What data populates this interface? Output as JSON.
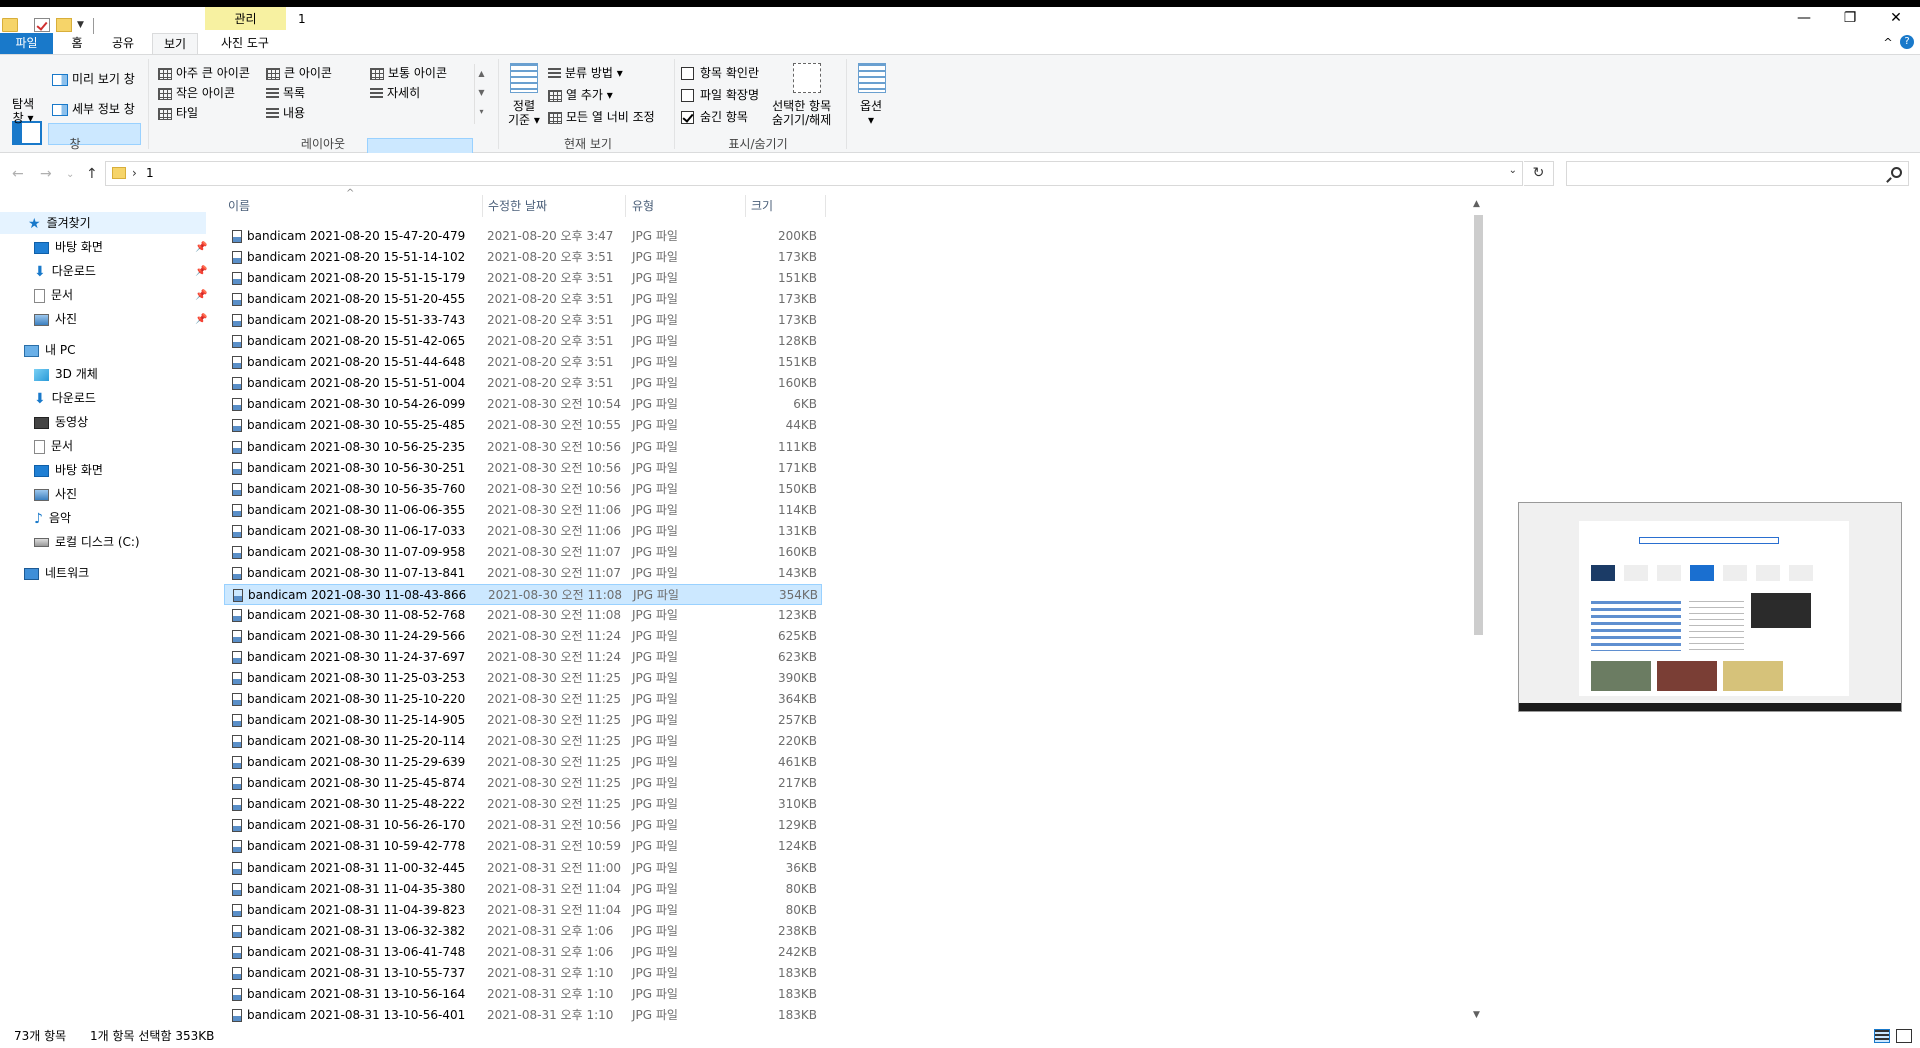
{
  "window": {
    "title": "1",
    "context_tab_group": "관리",
    "minimize_glyph": "—",
    "maximize_glyph": "❐",
    "close_glyph": "✕",
    "help_glyph": "?",
    "ribbon_toggle_glyph": "^"
  },
  "ribbon_tabs": [
    "파일",
    "홈",
    "공유",
    "보기",
    "사진 도구"
  ],
  "ribbon": {
    "panes": {
      "nav_pane": "탐색\n창 ▾",
      "preview_pane": "미리 보기 창",
      "details_pane": "세부 정보 창",
      "label": "창"
    },
    "layout": {
      "items": [
        "아주 큰 아이콘",
        "큰 아이콘",
        "보통 아이콘",
        "작은 아이콘",
        "목록",
        "자세히",
        "타일",
        "내용"
      ],
      "label": "레이아웃"
    },
    "current_view": {
      "sort": "정렬\n기준 ▾",
      "group_by": "분류 방법 ▾",
      "add_columns": "열 추가 ▾",
      "fit_columns": "모든 열 너비 조정",
      "label": "현재 보기"
    },
    "show_hide": {
      "item_checkboxes": "항목 확인란",
      "file_extensions": "파일 확장명",
      "hidden_items": "숨긴 항목",
      "hide_selected": "선택한 항목\n숨기기/해제",
      "label": "표시/숨기기"
    },
    "options": "옵션\n▾"
  },
  "address": {
    "path": "1",
    "back": "←",
    "forward": "→",
    "recent": "⌄",
    "up": "↑",
    "refresh": "↻",
    "search_placeholder": ""
  },
  "nav": {
    "quick_access": "즐겨찾기",
    "quick_items": [
      "바탕 화면",
      "다운로드",
      "문서",
      "사진"
    ],
    "this_pc": "내 PC",
    "pc_items": [
      "3D 개체",
      "다운로드",
      "동영상",
      "문서",
      "바탕 화면",
      "사진",
      "음악",
      "로컬 디스크 (C:)"
    ],
    "network": "네트워크"
  },
  "columns": {
    "name": "이름",
    "date": "수정한 날짜",
    "type": "유형",
    "size": "크기"
  },
  "files": [
    {
      "name": "bandicam 2021-08-20 15-47-20-479",
      "date": "2021-08-20 오후 3:47",
      "type": "JPG 파일",
      "size": "200KB"
    },
    {
      "name": "bandicam 2021-08-20 15-51-14-102",
      "date": "2021-08-20 오후 3:51",
      "type": "JPG 파일",
      "size": "173KB"
    },
    {
      "name": "bandicam 2021-08-20 15-51-15-179",
      "date": "2021-08-20 오후 3:51",
      "type": "JPG 파일",
      "size": "151KB"
    },
    {
      "name": "bandicam 2021-08-20 15-51-20-455",
      "date": "2021-08-20 오후 3:51",
      "type": "JPG 파일",
      "size": "173KB"
    },
    {
      "name": "bandicam 2021-08-20 15-51-33-743",
      "date": "2021-08-20 오후 3:51",
      "type": "JPG 파일",
      "size": "173KB"
    },
    {
      "name": "bandicam 2021-08-20 15-51-42-065",
      "date": "2021-08-20 오후 3:51",
      "type": "JPG 파일",
      "size": "128KB"
    },
    {
      "name": "bandicam 2021-08-20 15-51-44-648",
      "date": "2021-08-20 오후 3:51",
      "type": "JPG 파일",
      "size": "151KB"
    },
    {
      "name": "bandicam 2021-08-20 15-51-51-004",
      "date": "2021-08-20 오후 3:51",
      "type": "JPG 파일",
      "size": "160KB"
    },
    {
      "name": "bandicam 2021-08-30 10-54-26-099",
      "date": "2021-08-30 오전 10:54",
      "type": "JPG 파일",
      "size": "6KB"
    },
    {
      "name": "bandicam 2021-08-30 10-55-25-485",
      "date": "2021-08-30 오전 10:55",
      "type": "JPG 파일",
      "size": "44KB"
    },
    {
      "name": "bandicam 2021-08-30 10-56-25-235",
      "date": "2021-08-30 오전 10:56",
      "type": "JPG 파일",
      "size": "111KB"
    },
    {
      "name": "bandicam 2021-08-30 10-56-30-251",
      "date": "2021-08-30 오전 10:56",
      "type": "JPG 파일",
      "size": "171KB"
    },
    {
      "name": "bandicam 2021-08-30 10-56-35-760",
      "date": "2021-08-30 오전 10:56",
      "type": "JPG 파일",
      "size": "150KB"
    },
    {
      "name": "bandicam 2021-08-30 11-06-06-355",
      "date": "2021-08-30 오전 11:06",
      "type": "JPG 파일",
      "size": "114KB"
    },
    {
      "name": "bandicam 2021-08-30 11-06-17-033",
      "date": "2021-08-30 오전 11:06",
      "type": "JPG 파일",
      "size": "131KB"
    },
    {
      "name": "bandicam 2021-08-30 11-07-09-958",
      "date": "2021-08-30 오전 11:07",
      "type": "JPG 파일",
      "size": "160KB"
    },
    {
      "name": "bandicam 2021-08-30 11-07-13-841",
      "date": "2021-08-30 오전 11:07",
      "type": "JPG 파일",
      "size": "143KB"
    },
    {
      "name": "bandicam 2021-08-30 11-08-43-866",
      "date": "2021-08-30 오전 11:08",
      "type": "JPG 파일",
      "size": "354KB",
      "selected": true
    },
    {
      "name": "bandicam 2021-08-30 11-08-52-768",
      "date": "2021-08-30 오전 11:08",
      "type": "JPG 파일",
      "size": "123KB"
    },
    {
      "name": "bandicam 2021-08-30 11-24-29-566",
      "date": "2021-08-30 오전 11:24",
      "type": "JPG 파일",
      "size": "625KB"
    },
    {
      "name": "bandicam 2021-08-30 11-24-37-697",
      "date": "2021-08-30 오전 11:24",
      "type": "JPG 파일",
      "size": "623KB"
    },
    {
      "name": "bandicam 2021-08-30 11-25-03-253",
      "date": "2021-08-30 오전 11:25",
      "type": "JPG 파일",
      "size": "390KB"
    },
    {
      "name": "bandicam 2021-08-30 11-25-10-220",
      "date": "2021-08-30 오전 11:25",
      "type": "JPG 파일",
      "size": "364KB"
    },
    {
      "name": "bandicam 2021-08-30 11-25-14-905",
      "date": "2021-08-30 오전 11:25",
      "type": "JPG 파일",
      "size": "257KB"
    },
    {
      "name": "bandicam 2021-08-30 11-25-20-114",
      "date": "2021-08-30 오전 11:25",
      "type": "JPG 파일",
      "size": "220KB"
    },
    {
      "name": "bandicam 2021-08-30 11-25-29-639",
      "date": "2021-08-30 오전 11:25",
      "type": "JPG 파일",
      "size": "461KB"
    },
    {
      "name": "bandicam 2021-08-30 11-25-45-874",
      "date": "2021-08-30 오전 11:25",
      "type": "JPG 파일",
      "size": "217KB"
    },
    {
      "name": "bandicam 2021-08-30 11-25-48-222",
      "date": "2021-08-30 오전 11:25",
      "type": "JPG 파일",
      "size": "310KB"
    },
    {
      "name": "bandicam 2021-08-31 10-56-26-170",
      "date": "2021-08-31 오전 10:56",
      "type": "JPG 파일",
      "size": "129KB"
    },
    {
      "name": "bandicam 2021-08-31 10-59-42-778",
      "date": "2021-08-31 오전 10:59",
      "type": "JPG 파일",
      "size": "124KB"
    },
    {
      "name": "bandicam 2021-08-31 11-00-32-445",
      "date": "2021-08-31 오전 11:00",
      "type": "JPG 파일",
      "size": "36KB"
    },
    {
      "name": "bandicam 2021-08-31 11-04-35-380",
      "date": "2021-08-31 오전 11:04",
      "type": "JPG 파일",
      "size": "80KB"
    },
    {
      "name": "bandicam 2021-08-31 11-04-39-823",
      "date": "2021-08-31 오전 11:04",
      "type": "JPG 파일",
      "size": "80KB"
    },
    {
      "name": "bandicam 2021-08-31 13-06-32-382",
      "date": "2021-08-31 오후 1:06",
      "type": "JPG 파일",
      "size": "238KB"
    },
    {
      "name": "bandicam 2021-08-31 13-06-41-748",
      "date": "2021-08-31 오후 1:06",
      "type": "JPG 파일",
      "size": "242KB"
    },
    {
      "name": "bandicam 2021-08-31 13-10-55-737",
      "date": "2021-08-31 오후 1:10",
      "type": "JPG 파일",
      "size": "183KB"
    },
    {
      "name": "bandicam 2021-08-31 13-10-56-164",
      "date": "2021-08-31 오후 1:10",
      "type": "JPG 파일",
      "size": "183KB"
    },
    {
      "name": "bandicam 2021-08-31 13-10-56-401",
      "date": "2021-08-31 오후 1:10",
      "type": "JPG 파일",
      "size": "183KB"
    }
  ],
  "status": {
    "count": "73개 항목",
    "selection": "1개 항목 선택함 353KB"
  },
  "colors": {
    "accent": "#1979ca",
    "selection": "#cce8ff",
    "context_tab": "#f7f1a1"
  }
}
